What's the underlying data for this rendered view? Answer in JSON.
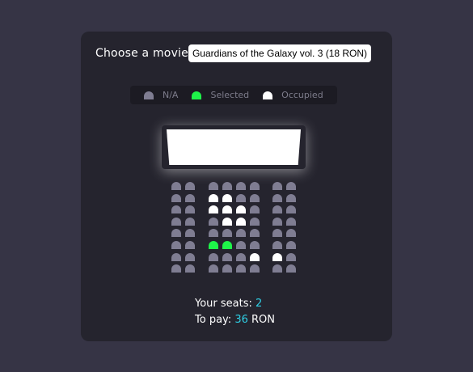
{
  "movie": {
    "label": "Choose a movie",
    "selected": "Guardians of the Galaxy vol. 3 (18 RON)"
  },
  "legend": [
    {
      "key": "na",
      "label": "N/A"
    },
    {
      "key": "selected",
      "label": "Selected"
    },
    {
      "key": "occupied",
      "label": "Occupied"
    }
  ],
  "colors": {
    "background": "#363445",
    "card": "#25242e",
    "seat_na": "#7f7d92",
    "seat_selected": "#1ef449",
    "seat_occupied": "#ffffff",
    "highlight": "#2fd0e6"
  },
  "seats": [
    [
      "na",
      "na",
      "na",
      "na",
      "na",
      "na",
      "na",
      "na",
      "na"
    ],
    [
      "na",
      "na",
      "occupied",
      "occupied",
      "na",
      "na",
      "na",
      "na",
      "na"
    ],
    [
      "na",
      "na",
      "occupied",
      "occupied",
      "occupied",
      "na",
      "na",
      "na",
      "na"
    ],
    [
      "na",
      "na",
      "na",
      "occupied",
      "occupied",
      "na",
      "na",
      "na",
      "na"
    ],
    [
      "na",
      "na",
      "na",
      "na",
      "na",
      "na",
      "na",
      "na",
      "na"
    ],
    [
      "na",
      "na",
      "selected",
      "selected",
      "na",
      "na",
      "na",
      "na",
      "na"
    ],
    [
      "na",
      "na",
      "na",
      "na",
      "na",
      "occupied",
      "occupied",
      "na",
      "na"
    ],
    [
      "na",
      "na",
      "na",
      "na",
      "na",
      "na",
      "na",
      "na",
      "na"
    ]
  ],
  "summary": {
    "seats_label": "Your seats:",
    "seats_count": "2",
    "pay_label": "To pay:",
    "pay_amount": "36",
    "currency": "RON"
  }
}
